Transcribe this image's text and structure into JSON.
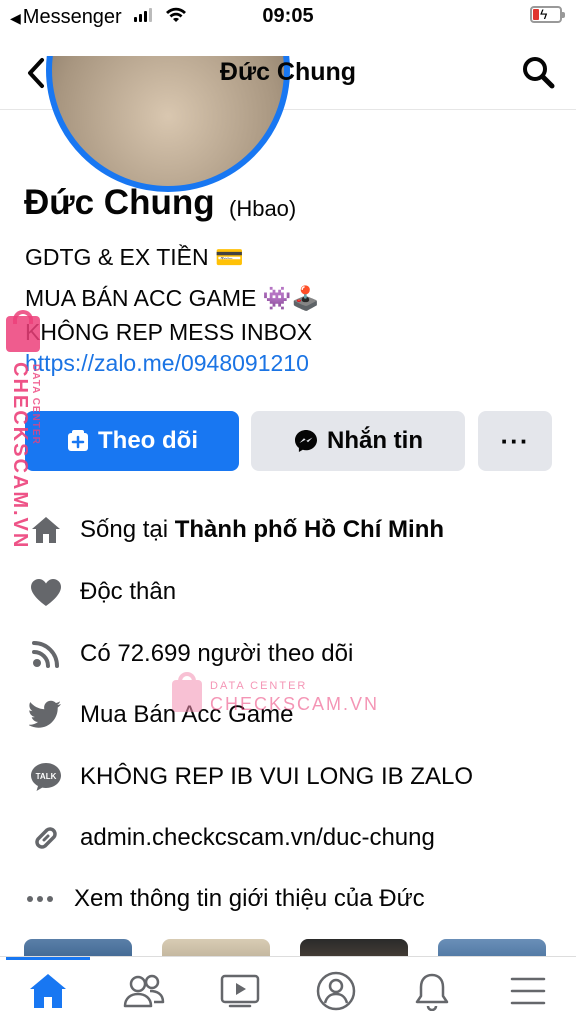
{
  "status_bar": {
    "back_app": "Messenger",
    "time": "09:05"
  },
  "header": {
    "title": "Đức Chung"
  },
  "profile": {
    "name": "Đức Chung",
    "alternate_name": "(Hbao)",
    "bio_lines": [
      "GDTG & EX TIỀN 💳",
      "MUA BÁN ACC GAME 👾🕹️",
      "KHÔNG REP MESS INBOX"
    ],
    "bio_link": "https://zalo.me/0948091210"
  },
  "actions": {
    "follow_label": "Theo dõi",
    "message_label": "Nhắn tin",
    "more_label": "···"
  },
  "info": {
    "lives_prefix": "Sống tại ",
    "lives_city": "Thành phố Hồ Chí Minh",
    "relationship": "Độc thân",
    "followers": "Có 72.699 người theo dõi",
    "twitter": "Mua Bán Acc Game",
    "talk": "KHÔNG REP IB VUI LONG IB ZALO",
    "website": "admin.checkcscam.vn/duc-chung",
    "see_more": "Xem thông tin giới thiệu của Đức"
  },
  "watermark": {
    "side_big": "CHECKSCAM.VN",
    "side_small": "DATA CENTER",
    "center_small": "DATA CENTER",
    "center_big": "CHECKSCAM.VN"
  },
  "colors": {
    "accent": "#1877f2",
    "button_gray": "#e4e6eb",
    "link": "#1b74e4",
    "watermark": "#ec407a"
  },
  "icons": {
    "back": "chevron-left-icon",
    "search": "search-icon",
    "home": "home-icon",
    "heart": "heart-icon",
    "rss": "rss-icon",
    "twitter": "twitter-icon",
    "talk": "talk-icon",
    "link": "link-icon",
    "nav": [
      "home-icon",
      "friends-icon",
      "video-icon",
      "profile-icon",
      "bell-icon",
      "menu-icon"
    ]
  }
}
